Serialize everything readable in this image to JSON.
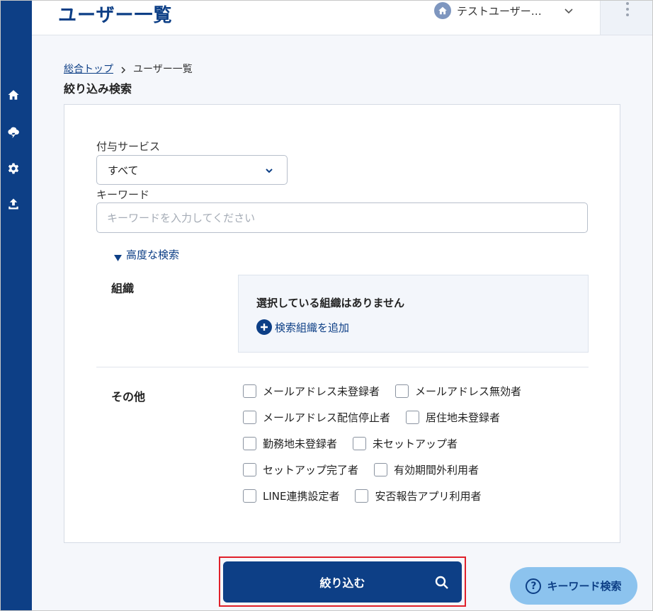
{
  "header": {
    "title": "ユーザー一覧",
    "user_name": "テストユーザー…"
  },
  "breadcrumb": {
    "home": "総合トップ",
    "current": "ユーザー一覧"
  },
  "section_title": "絞り込み検索",
  "filter": {
    "service_label": "付与サービス",
    "service_value": "すべて",
    "keyword_label": "キーワード",
    "keyword_placeholder": "キーワードを入力してください",
    "keyword_value": "",
    "advanced_label": "高度な検索"
  },
  "organization": {
    "label": "組織",
    "empty_text": "選択している組織はありません",
    "add_label": "検索組織を追加"
  },
  "other": {
    "label": "その他",
    "rows": [
      [
        "メールアドレス未登録者",
        "メールアドレス無効者"
      ],
      [
        "メールアドレス配信停止者",
        "居住地未登録者"
      ],
      [
        "勤務地未登録者",
        "未セットアップ者"
      ],
      [
        "セットアップ完了者",
        "有効期間外利用者"
      ],
      [
        "LINE連携設定者",
        "安否報告アプリ利用者"
      ]
    ]
  },
  "buttons": {
    "submit": "絞り込む",
    "keyword_help": "キーワード検索",
    "help_glyph": "?"
  },
  "colors": {
    "primary": "#0d3f86",
    "highlight_border": "#e0202a",
    "help_button": "#8cc3ee"
  },
  "icons": {
    "sidebar": [
      "home-icon",
      "cloud-lightning-icon",
      "gear-icon",
      "upload-icon"
    ]
  }
}
